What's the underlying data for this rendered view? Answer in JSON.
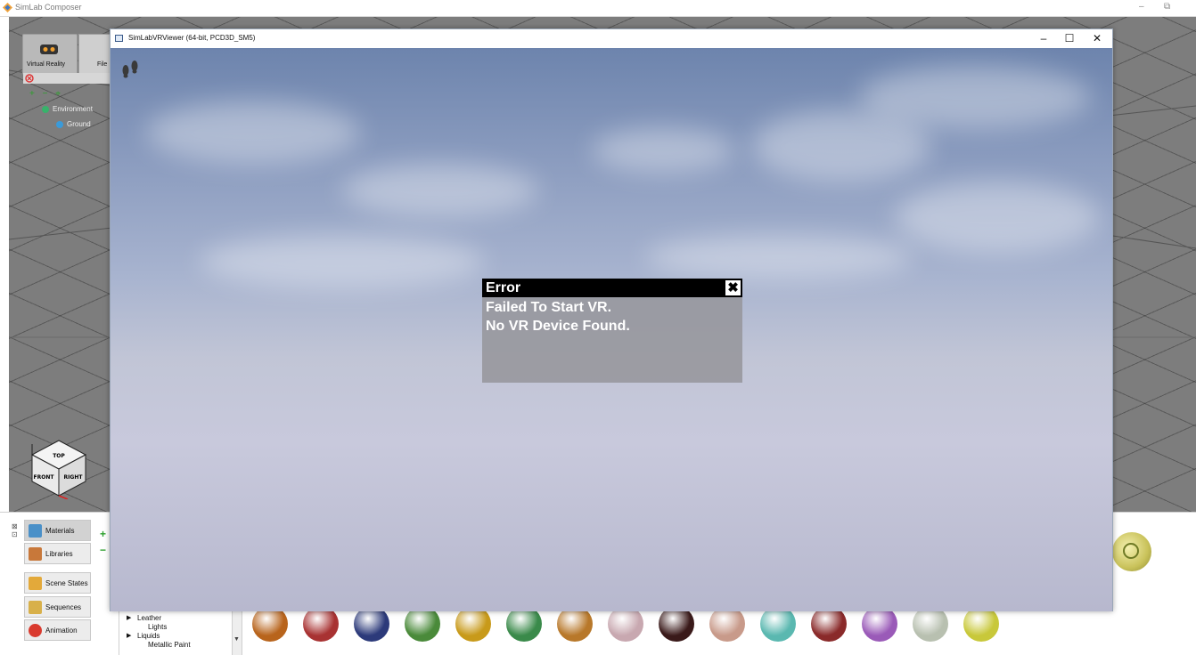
{
  "app": {
    "title": "SimLab Composer",
    "window_controls": {
      "minimize": "–",
      "restore": "⧉"
    }
  },
  "ribbon": {
    "virtual_reality_label": "Virtual Reality",
    "file_label": "File"
  },
  "scene_tree": {
    "tools": "+ − ⌖",
    "items": [
      {
        "label": "Environment",
        "icon": "environment-icon",
        "color": "#38b26b"
      },
      {
        "label": "Ground",
        "icon": "ground-icon",
        "color": "#3a9ad9"
      }
    ]
  },
  "viewcube": {
    "top": "TOP",
    "front": "FRONT",
    "right": "RIGHT"
  },
  "bottom_panel": {
    "sidebar": [
      {
        "label": "Materials",
        "icon": "materials-icon",
        "color": "#4a90c8",
        "active": true
      },
      {
        "label": "Libraries",
        "icon": "libraries-icon",
        "color": "#c8783a",
        "active": false
      },
      {
        "label": "Scene States",
        "icon": "scene-states-icon",
        "color": "#e3a93a",
        "active": false
      },
      {
        "label": "Sequences",
        "icon": "sequences-icon",
        "color": "#d8b04a",
        "active": false
      },
      {
        "label": "Animation",
        "icon": "animation-icon",
        "color": "#d93a2e",
        "active": false
      }
    ],
    "categories": [
      "Leather",
      "Lights",
      "Liquids",
      "Metallic Paint"
    ],
    "swatch_colors": [
      "#b8641c",
      "#a83232",
      "#2c3a7a",
      "#4a8a3a",
      "#c89a1a",
      "#3a8a4a",
      "#b8782a",
      "#c8a8b0",
      "#3a1a1a",
      "#c89a8a",
      "#5ab8b0",
      "#8a2a2a",
      "#9a5ab8",
      "#b8c0b0",
      "#c8c83a"
    ]
  },
  "viewer": {
    "title": "SimLabVRViewer (64-bit, PCD3D_SM5)",
    "controls": {
      "minimize": "–",
      "maximize": "☐",
      "close": "✕"
    }
  },
  "error_dialog": {
    "title": "Error",
    "close": "✖",
    "lines": [
      "Failed To Start VR.",
      "No VR Device Found."
    ]
  }
}
